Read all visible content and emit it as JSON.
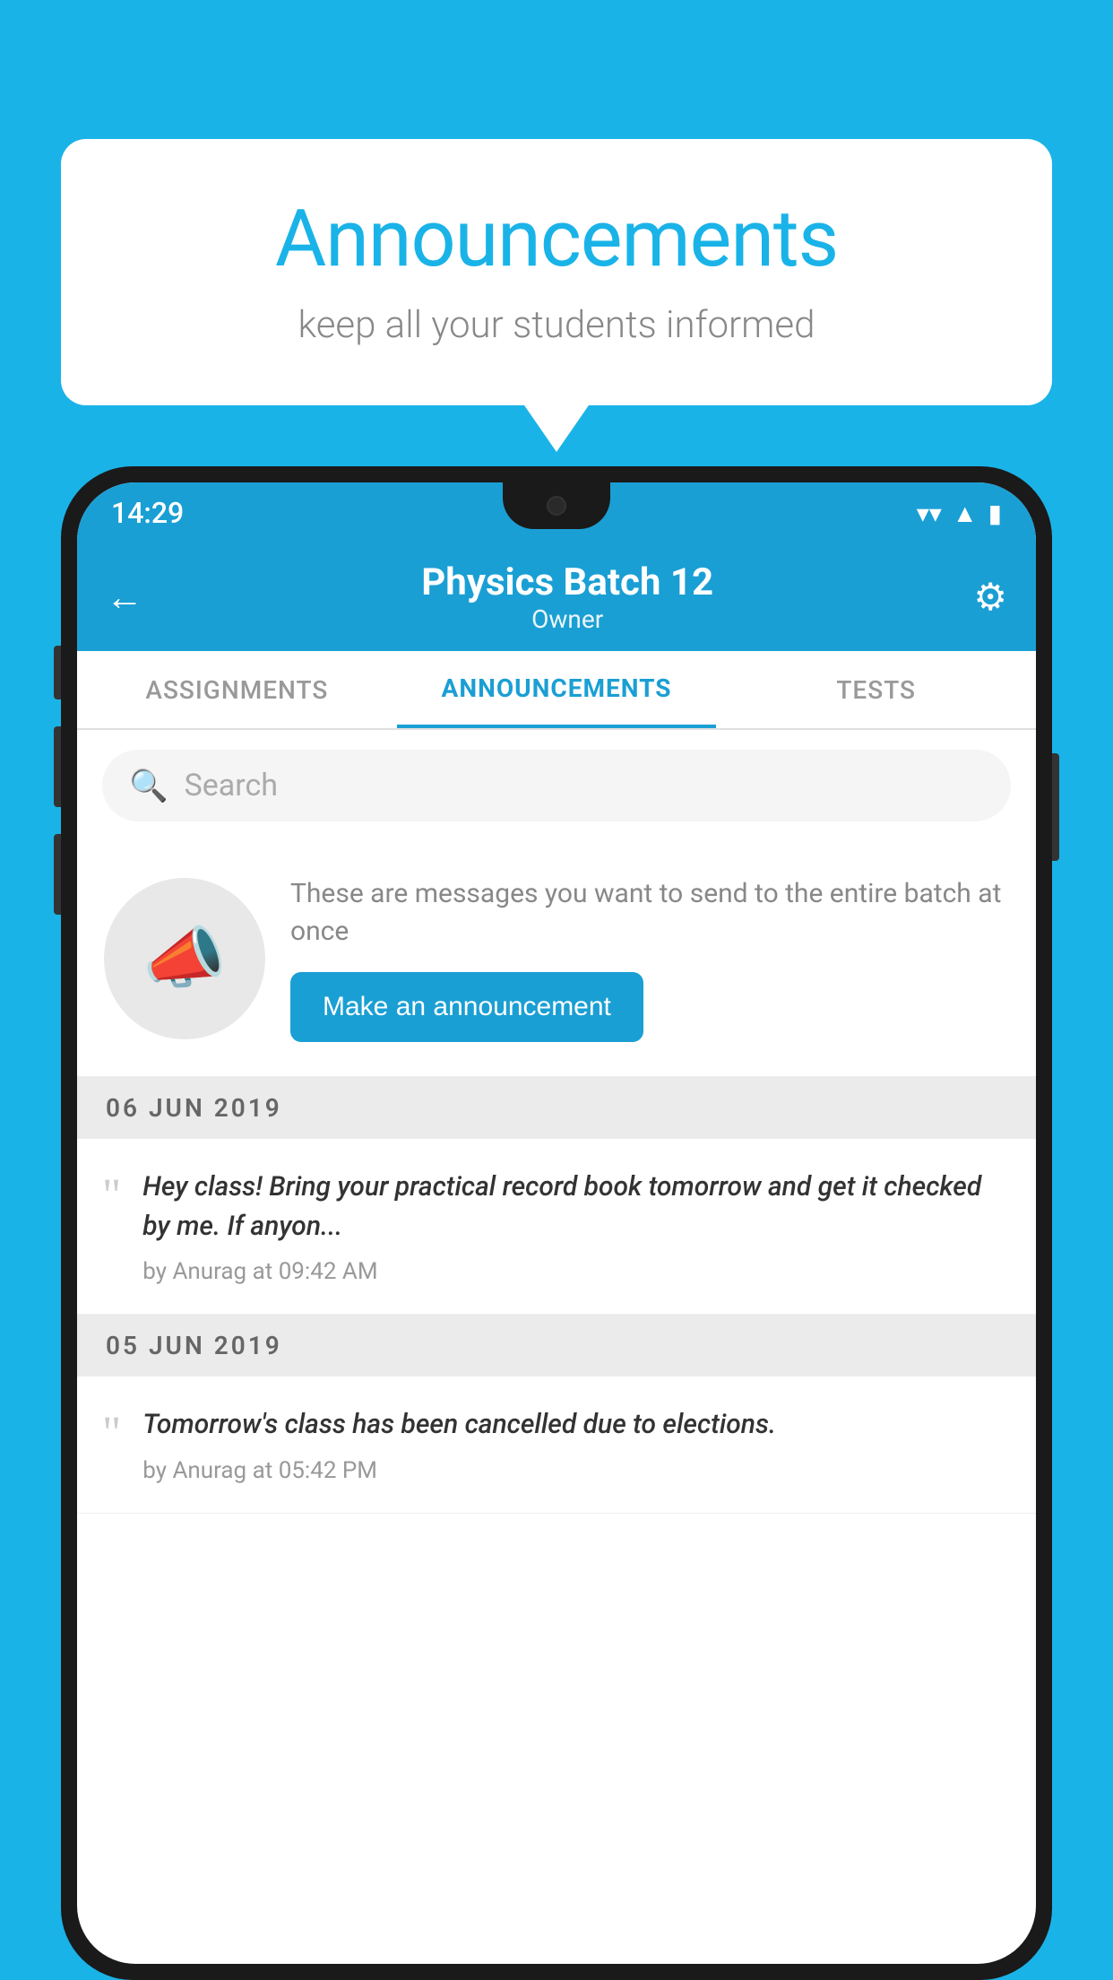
{
  "bubble": {
    "title": "Announcements",
    "subtitle": "keep all your students informed"
  },
  "statusBar": {
    "time": "14:29",
    "icons": [
      "wifi",
      "signal",
      "battery"
    ]
  },
  "header": {
    "title": "Physics Batch 12",
    "subtitle": "Owner",
    "backLabel": "←"
  },
  "tabs": [
    {
      "label": "ASSIGNMENTS",
      "active": false
    },
    {
      "label": "ANNOUNCEMENTS",
      "active": true
    },
    {
      "label": "TESTS",
      "active": false
    },
    {
      "label": "...",
      "active": false
    }
  ],
  "search": {
    "placeholder": "Search"
  },
  "promo": {
    "text": "These are messages you want to send to the entire batch at once",
    "buttonLabel": "Make an announcement"
  },
  "announcements": [
    {
      "date": "06  JUN  2019",
      "text": "Hey class! Bring your practical record book tomorrow and get it checked by me. If anyon...",
      "meta": "by Anurag at 09:42 AM"
    },
    {
      "date": "05  JUN  2019",
      "text": "Tomorrow's class has been cancelled due to elections.",
      "meta": "by Anurag at 05:42 PM"
    }
  ],
  "icons": {
    "back": "←",
    "settings": "⚙",
    "search": "🔍",
    "megaphone": "📣",
    "quote": "““"
  },
  "colors": {
    "primary": "#1a9fd4",
    "background": "#1ab3e8",
    "tabActive": "#1a9fd4",
    "dateBg": "#ebebeb"
  }
}
